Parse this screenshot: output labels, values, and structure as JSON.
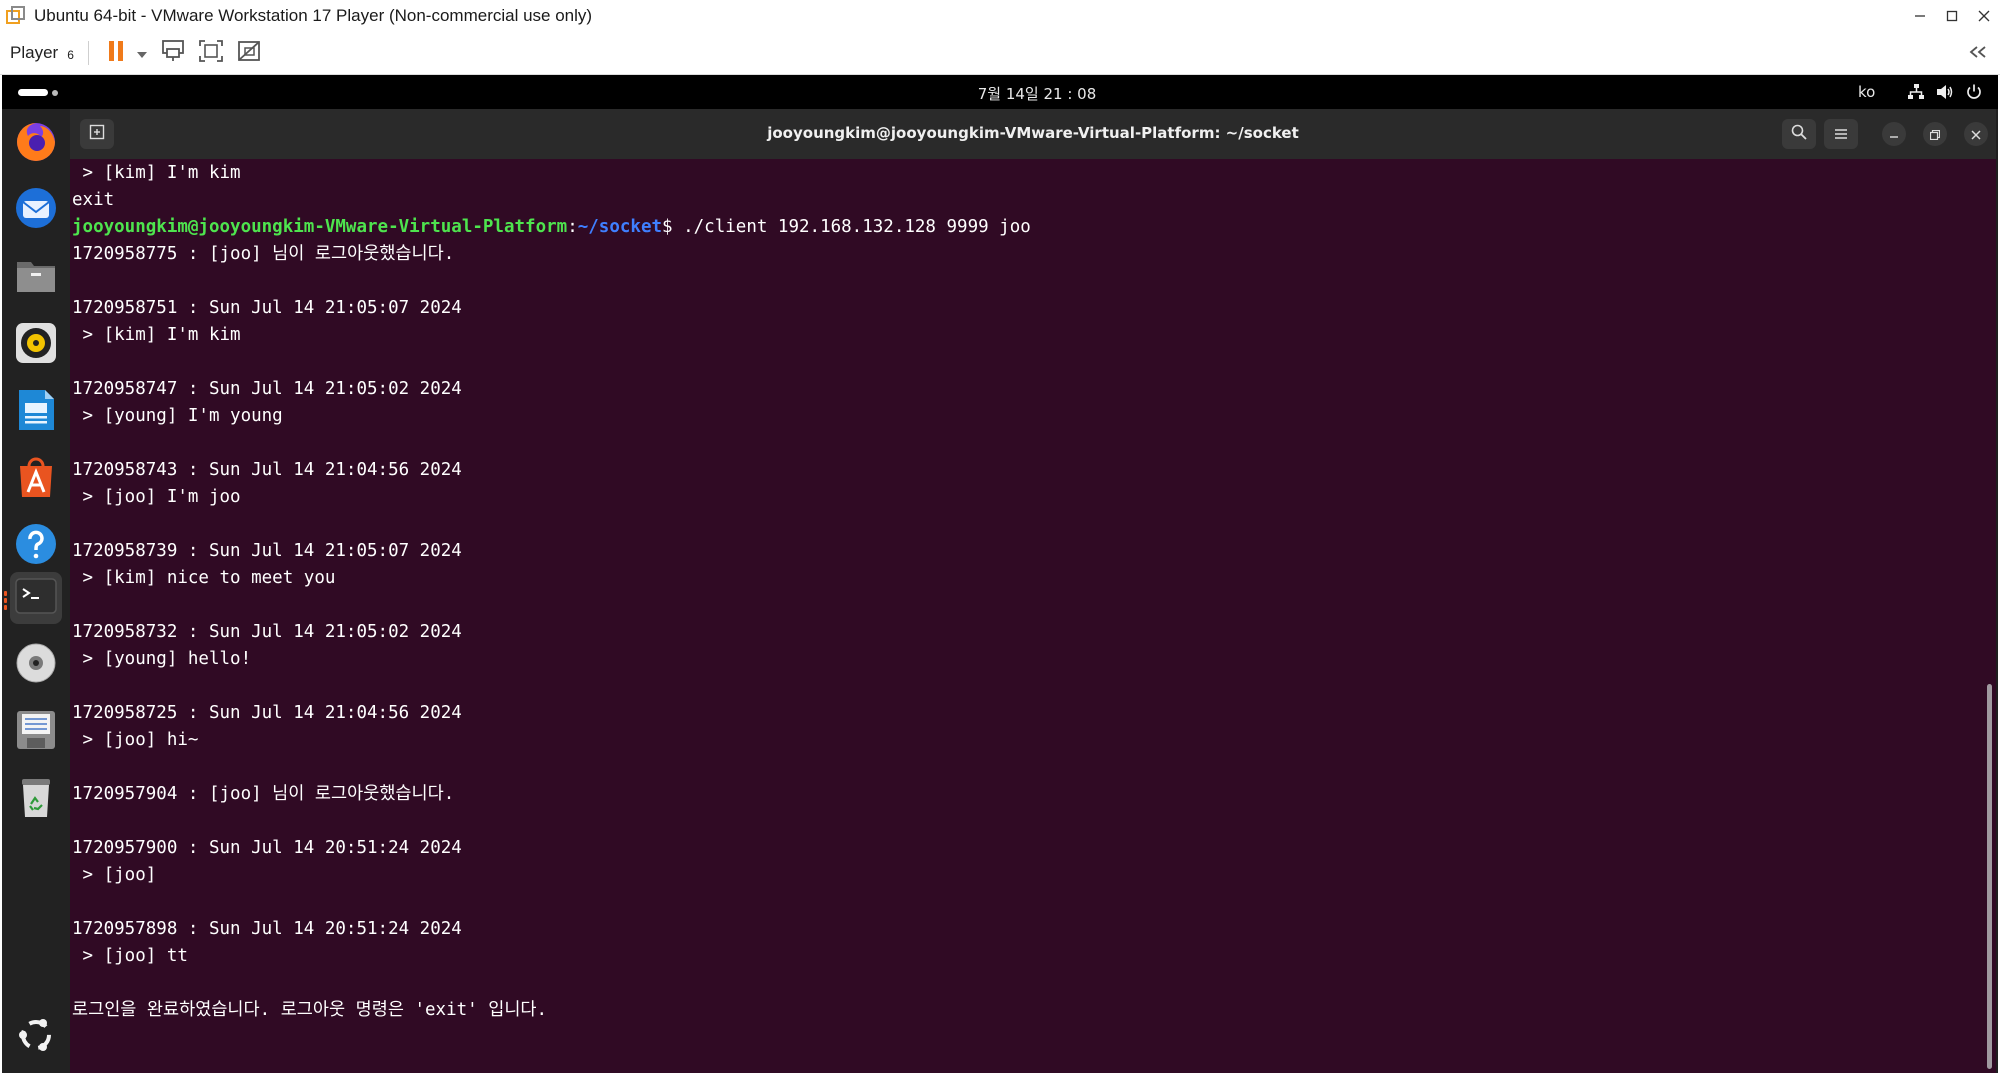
{
  "window": {
    "title": "Ubuntu 64-bit - VMware Workstation 17 Player (Non-commercial use only)",
    "controls": [
      "minimize-icon",
      "maximize-icon",
      "close-icon"
    ]
  },
  "toolbar": {
    "player_label": "Player",
    "player_badge": "6",
    "icons": [
      "pause-icon",
      "dropdown-arrow-icon",
      "send-ctrl-alt-del-icon",
      "full-screen-icon",
      "unity-icon"
    ],
    "collapse_icon": "double-chevron-left-icon"
  },
  "gnome_bar": {
    "clock": "7월 14일 21 : 08",
    "input_source": "ko",
    "icons": [
      "network-icon",
      "volume-icon",
      "power-icon"
    ]
  },
  "dock": {
    "items": [
      {
        "name": "firefox",
        "running": false
      },
      {
        "name": "thunderbird",
        "running": false
      },
      {
        "name": "files",
        "running": false
      },
      {
        "name": "rhythmbox",
        "running": false
      },
      {
        "name": "libreoffice-writer",
        "running": false
      },
      {
        "name": "app-center",
        "running": false
      },
      {
        "name": "help",
        "running": false
      },
      {
        "name": "terminal",
        "running": true
      },
      {
        "name": "disc",
        "running": false
      },
      {
        "name": "floppy",
        "running": false
      },
      {
        "name": "trash",
        "running": false
      }
    ],
    "show_apps_icon": "ubuntu-logo-icon"
  },
  "terminal": {
    "title": "jooyoungkim@jooyoungkim-VMware-Virtual-Platform: ~/socket",
    "prompt": {
      "user_host": "jooyoungkim@jooyoungkim-VMware-Virtual-Platform",
      "colon": ":",
      "path": "~/socket",
      "command": "$ ./client 192.168.132.128 9999 joo"
    },
    "lines_before": [
      " > [kim] I'm kim",
      "exit"
    ],
    "lines_after": [
      "1720958775 : [joo] 님이 로그아웃했습니다.",
      "",
      "1720958751 : Sun Jul 14 21:05:07 2024",
      " > [kim] I'm kim",
      "",
      "1720958747 : Sun Jul 14 21:05:02 2024",
      " > [young] I'm young",
      "",
      "1720958743 : Sun Jul 14 21:04:56 2024",
      " > [joo] I'm joo",
      "",
      "1720958739 : Sun Jul 14 21:05:07 2024",
      " > [kim] nice to meet you",
      "",
      "1720958732 : Sun Jul 14 21:05:02 2024",
      " > [young] hello!",
      "",
      "1720958725 : Sun Jul 14 21:04:56 2024",
      " > [joo] hi~",
      "",
      "1720957904 : [joo] 님이 로그아웃했습니다.",
      "",
      "1720957900 : Sun Jul 14 20:51:24 2024",
      " > [joo]",
      "",
      "1720957898 : Sun Jul 14 20:51:24 2024",
      " > [joo] tt",
      "",
      "로그인을 완료하였습니다. 로그아웃 명령은 'exit' 입니다."
    ]
  }
}
